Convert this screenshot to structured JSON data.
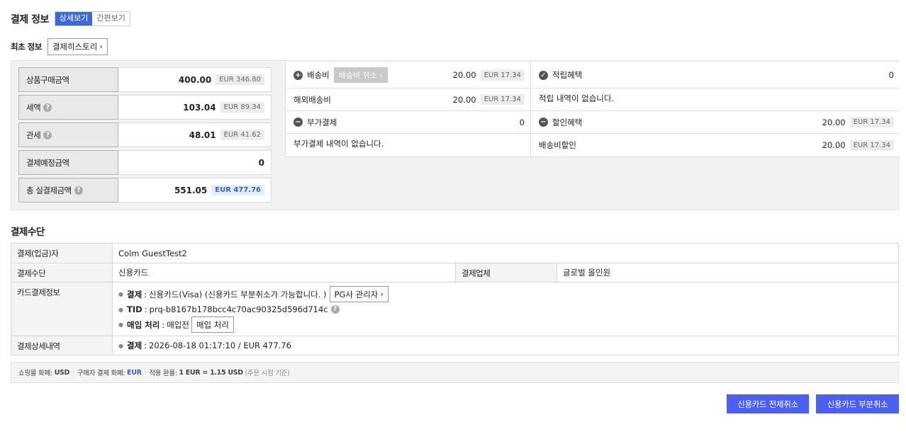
{
  "header": {
    "title": "결제 정보",
    "view_detail": "상세보기",
    "view_simple": "간편보기"
  },
  "first_info": {
    "label": "최초 정보",
    "history_button": "결제히스토리"
  },
  "summary": {
    "product_amount": {
      "label": "상품구매금액",
      "value": "400.00",
      "eur": "EUR 346.80"
    },
    "tax": {
      "label": "세액",
      "value": "103.04",
      "eur": "EUR 89.34"
    },
    "duty": {
      "label": "관세",
      "value": "48.01",
      "eur": "EUR 41.62"
    },
    "scheduled": {
      "label": "결제예정금액",
      "value": "0"
    },
    "total": {
      "label": "총 실결제금액",
      "value": "551.05",
      "eur": "EUR 477.76"
    }
  },
  "detail": {
    "shipping": {
      "label": "배송비",
      "cancel_button": "배송비 취소",
      "value": "20.00",
      "eur": "EUR 17.34"
    },
    "overseas_shipping": {
      "label": "해외배송비",
      "value": "20.00",
      "eur": "EUR 17.34"
    },
    "additional": {
      "label": "부가결제",
      "value": "0",
      "empty": "부가결제 내역이 없습니다."
    },
    "points": {
      "label": "적립혜택",
      "value": "0",
      "empty": "적립 내역이 없습니다."
    },
    "discount": {
      "label": "할인혜택",
      "value": "20.00",
      "eur": "EUR 17.34"
    },
    "shipping_discount": {
      "label": "배송비할인",
      "value": "20.00",
      "eur": "EUR 17.34"
    }
  },
  "payment_method": {
    "title": "결제수단",
    "payer_label": "결제(입금)자",
    "payer": "Colm GuestTest2",
    "method_label": "결제수단",
    "method": "신용카드",
    "provider_label": "결제업체",
    "provider": "글로벌 올인원",
    "card_info_label": "카드결제정보",
    "card_payment_key": "결제",
    "card_payment_value": "신용카드(Visa) (신용카드 부분취소가 가능합니다. )",
    "pg_button": "PG사 관리자",
    "tid_key": "TID",
    "tid_value": "prq-b8167b178bcc4c70ac90325d596d714c",
    "purchase_key": "매입 처리",
    "purchase_value": "매입전",
    "purchase_button": "매입 처리",
    "detail_label": "결제상세내역",
    "detail_key": "결제",
    "detail_value": "2026-08-18 01:17:10 / EUR 477.76"
  },
  "currency_info": {
    "shop_label": "쇼핑몰 화폐:",
    "shop_value": "USD",
    "buyer_label": "구매자 결제 화폐:",
    "buyer_value": "EUR",
    "rate_label": "적용 환율:",
    "rate_value": "1 EUR = 1.15 USD",
    "rate_note": "(주문 시점 기준)"
  },
  "actions": {
    "full_cancel": "신용카드 전체취소",
    "partial_cancel": "신용카드 부분취소"
  }
}
